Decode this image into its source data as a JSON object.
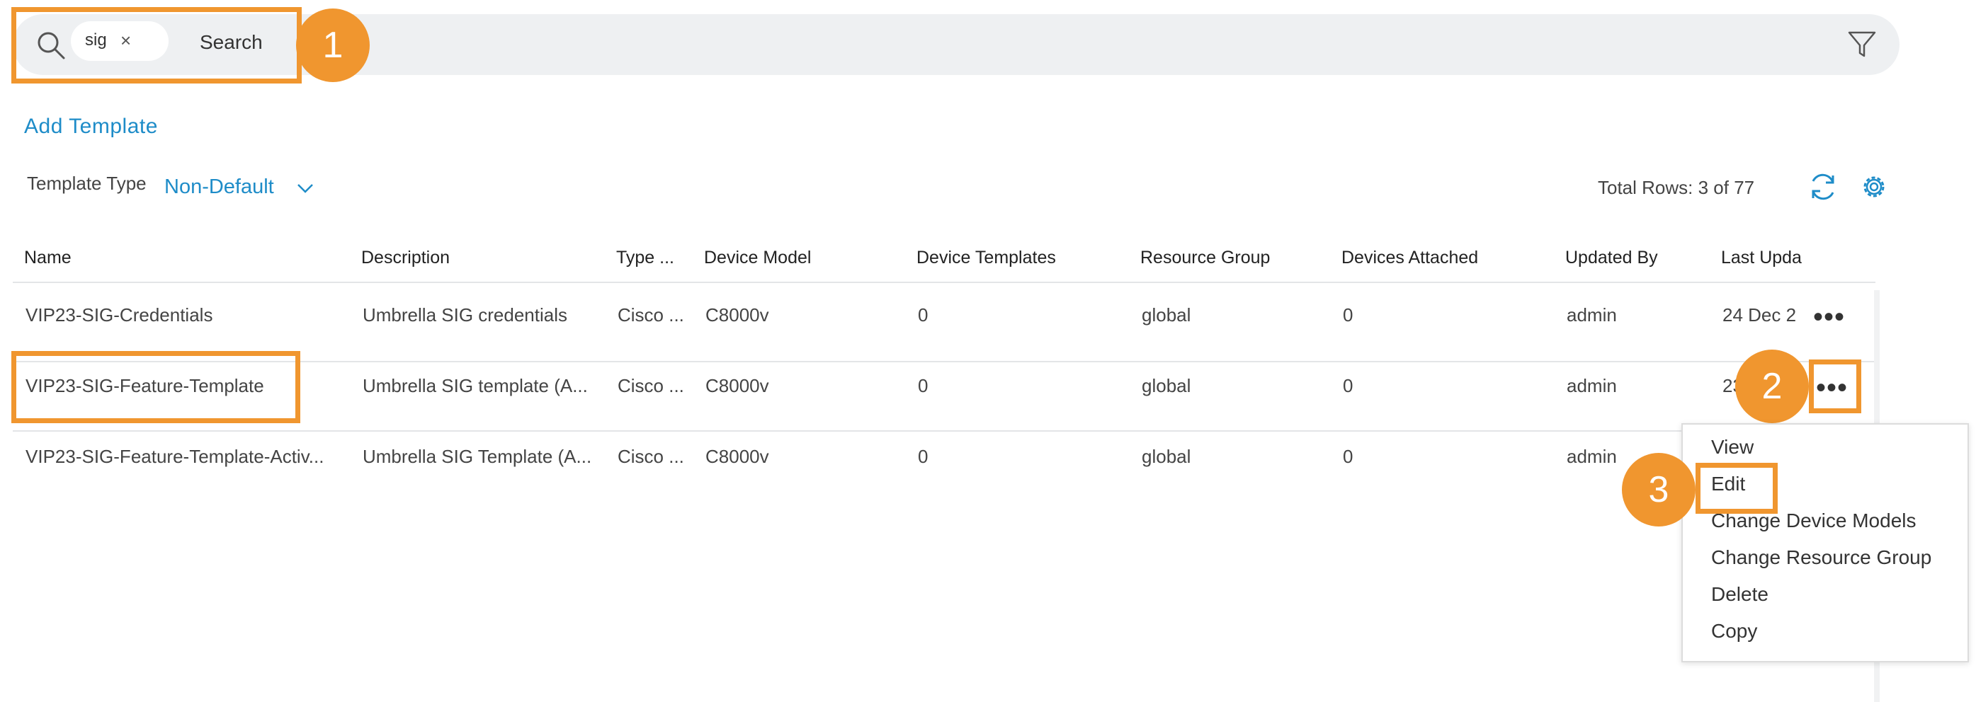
{
  "search": {
    "chip_text": "sig",
    "chip_remove": "×",
    "button_label": "Search"
  },
  "callouts": [
    "1",
    "2",
    "3"
  ],
  "add_template_label": "Add Template",
  "template_type": {
    "label": "Template Type",
    "value": "Non-Default"
  },
  "total_rows": "Total Rows: 3 of 77",
  "table": {
    "columns": [
      "Name",
      "Description",
      "Type ...",
      "Device Model",
      "Device Templates",
      "Resource Group",
      "Devices Attached",
      "Updated By",
      "Last Upda"
    ],
    "rows": [
      [
        "VIP23-SIG-Credentials",
        "Umbrella SIG credentials",
        "Cisco ...",
        "C8000v",
        "0",
        "global",
        "0",
        "admin",
        "24 Dec 2"
      ],
      [
        "VIP23-SIG-Feature-Template",
        "Umbrella SIG template (A...",
        "Cisco ...",
        "C8000v",
        "0",
        "global",
        "0",
        "admin",
        "23"
      ],
      [
        "VIP23-SIG-Feature-Template-Activ...",
        "Umbrella SIG Template (A...",
        "Cisco ...",
        "C8000v",
        "0",
        "global",
        "0",
        "admin",
        ""
      ]
    ]
  },
  "row_actions_glyph": "•••",
  "context_menu": [
    "View",
    "Edit",
    "Change Device Models",
    "Change Resource Group",
    "Delete",
    "Copy"
  ],
  "colors": {
    "accent": "#1e8cc8",
    "highlight": "#f0962f",
    "search_bg": "#eef0f2"
  }
}
